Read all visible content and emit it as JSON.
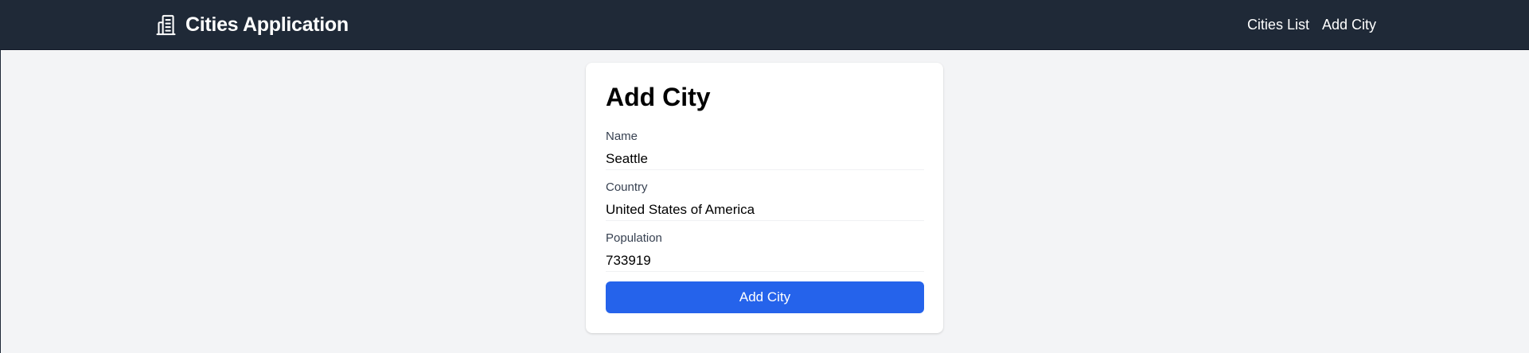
{
  "navbar": {
    "brand_icon": "building-icon",
    "brand_title": "Cities Application",
    "links": [
      {
        "label": "Cities List"
      },
      {
        "label": "Add City"
      }
    ],
    "background": "#1f2937"
  },
  "form": {
    "title": "Add City",
    "fields": {
      "name": {
        "label": "Name",
        "value": "Seattle"
      },
      "country": {
        "label": "Country",
        "value": "United States of America"
      },
      "population": {
        "label": "Population",
        "value": "733919"
      }
    },
    "submit_label": "Add City",
    "accent": "#2563eb"
  }
}
